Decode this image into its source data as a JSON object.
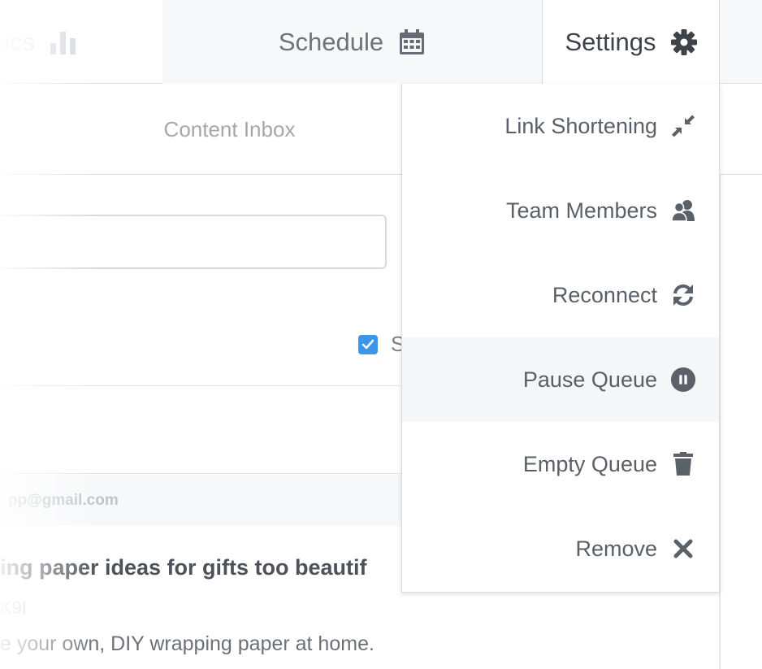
{
  "tabs": {
    "analytics_label": "ics",
    "schedule_label": "Schedule",
    "settings_label": "Settings"
  },
  "subnav": {
    "content_inbox_label": "Content Inbox"
  },
  "form": {
    "checkbox_label": "S"
  },
  "account": {
    "email": "pp@gmail.com"
  },
  "post": {
    "title": "ing paper ideas for gifts too beautif",
    "link": "K9I",
    "description": "e your own, DIY wrapping paper at home."
  },
  "settings_menu": {
    "items": [
      {
        "label": "Link Shortening",
        "icon": "compress-arrows-icon"
      },
      {
        "label": "Team Members",
        "icon": "users-icon"
      },
      {
        "label": "Reconnect",
        "icon": "refresh-icon"
      },
      {
        "label": "Pause Queue",
        "icon": "pause-circle-icon"
      },
      {
        "label": "Empty Queue",
        "icon": "trash-icon"
      },
      {
        "label": "Remove",
        "icon": "close-icon"
      }
    ]
  },
  "colors": {
    "accent": "#3b95e8",
    "icon": "#5a6168"
  }
}
